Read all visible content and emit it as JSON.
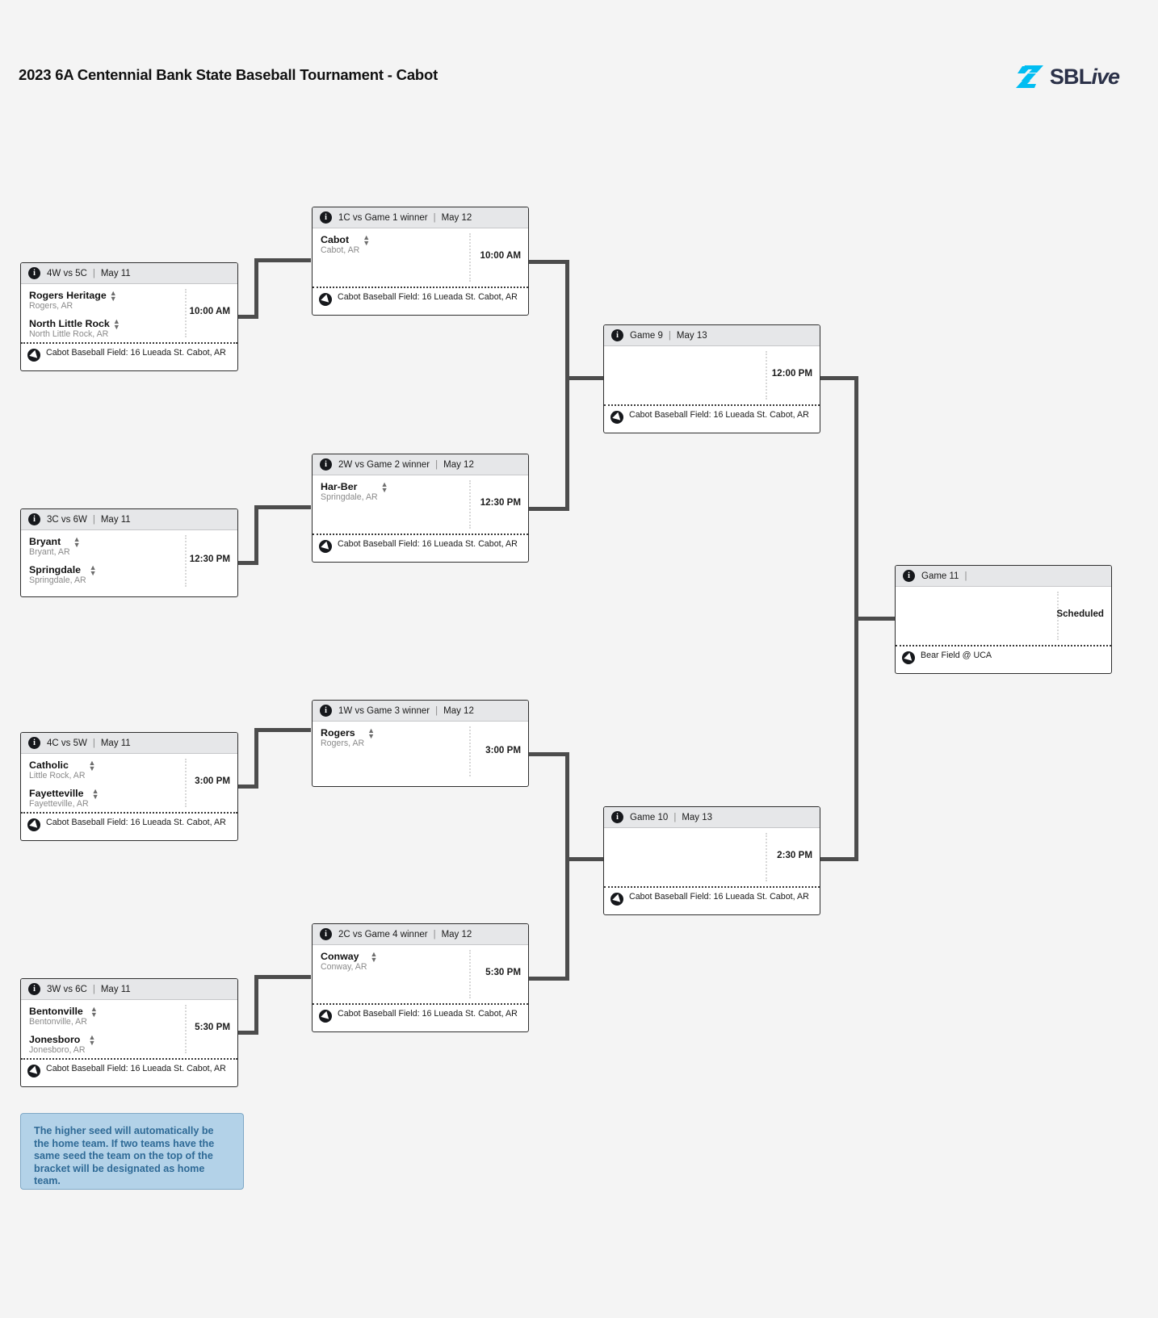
{
  "header": {
    "title": "2023 6A Centennial Bank State Baseball Tournament - Cabot",
    "logo_primary": "SBL",
    "logo_secondary": "ive",
    "logo_mark_color": "#00bdf2",
    "logo_text_color": "#2b3148"
  },
  "venues": {
    "cabot": "Cabot Baseball Field: 16 Lueada St. Cabot, AR",
    "uca": "Bear Field @ UCA"
  },
  "note": {
    "text": "The higher seed will automatically be the home team. If two teams have the same seed the team on the top of the bracket will be designated as home team.",
    "background": "#b3d2e8",
    "text_color": "#2f6a96"
  },
  "icons": {
    "info": "info-icon",
    "navigation": "navigation-icon",
    "spinner_up": "▲",
    "spinner_down": "▼",
    "separator": "|"
  },
  "games": [
    {
      "id": "game1",
      "matchup": "4W vs 5C",
      "date": "May 11",
      "time": "10:00 AM",
      "venue": "Cabot Baseball Field: 16 Lueada St. Cabot, AR",
      "teams": [
        {
          "name": "Rogers Heritage",
          "city": "Rogers, AR"
        },
        {
          "name": "North Little Rock",
          "city": "North Little Rock, AR"
        }
      ]
    },
    {
      "id": "game2",
      "matchup": "3C vs 6W",
      "date": "May 11",
      "time": "12:30 PM",
      "venue": "",
      "teams": [
        {
          "name": "Bryant",
          "city": "Bryant, AR"
        },
        {
          "name": "Springdale",
          "city": "Springdale, AR"
        }
      ]
    },
    {
      "id": "game3",
      "matchup": "4C vs 5W",
      "date": "May 11",
      "time": "3:00 PM",
      "venue": "Cabot Baseball Field: 16 Lueada St. Cabot, AR",
      "teams": [
        {
          "name": "Catholic",
          "city": "Little Rock, AR"
        },
        {
          "name": "Fayetteville",
          "city": "Fayetteville, AR"
        }
      ]
    },
    {
      "id": "game4",
      "matchup": "3W vs 6C",
      "date": "May 11",
      "time": "5:30 PM",
      "venue": "Cabot Baseball Field: 16 Lueada St. Cabot, AR",
      "teams": [
        {
          "name": "Bentonville",
          "city": "Bentonville, AR"
        },
        {
          "name": "Jonesboro",
          "city": "Jonesboro, AR"
        }
      ]
    },
    {
      "id": "game5",
      "matchup": "1C vs Game 1 winner",
      "date": "May 12",
      "time": "10:00 AM",
      "venue": "Cabot Baseball Field: 16 Lueada St. Cabot, AR",
      "teams": [
        {
          "name": "Cabot",
          "city": "Cabot, AR"
        },
        {
          "name": "",
          "city": ""
        }
      ]
    },
    {
      "id": "game6",
      "matchup": "2W vs Game 2 winner",
      "date": "May 12",
      "time": "12:30 PM",
      "venue": "Cabot Baseball Field: 16 Lueada St. Cabot, AR",
      "teams": [
        {
          "name": "Har-Ber",
          "city": "Springdale, AR"
        },
        {
          "name": "",
          "city": ""
        }
      ]
    },
    {
      "id": "game7",
      "matchup": "1W vs Game 3 winner",
      "date": "May 12",
      "time": "3:00 PM",
      "venue": "",
      "teams": [
        {
          "name": "Rogers",
          "city": "Rogers, AR"
        },
        {
          "name": "",
          "city": ""
        }
      ]
    },
    {
      "id": "game8",
      "matchup": "2C vs Game 4 winner",
      "date": "May 12",
      "time": "5:30 PM",
      "venue": "Cabot Baseball Field: 16 Lueada St. Cabot, AR",
      "teams": [
        {
          "name": "Conway",
          "city": "Conway, AR"
        },
        {
          "name": "",
          "city": ""
        }
      ]
    },
    {
      "id": "game9",
      "matchup": "Game 9",
      "date": "May 13",
      "time": "12:00 PM",
      "venue": "Cabot Baseball Field: 16 Lueada St. Cabot, AR",
      "teams": [
        {
          "name": "",
          "city": ""
        },
        {
          "name": "",
          "city": ""
        }
      ]
    },
    {
      "id": "game10",
      "matchup": "Game 10",
      "date": "May 13",
      "time": "2:30 PM",
      "venue": "Cabot Baseball Field: 16 Lueada St. Cabot, AR",
      "teams": [
        {
          "name": "",
          "city": ""
        },
        {
          "name": "",
          "city": ""
        }
      ]
    },
    {
      "id": "game11",
      "matchup": "Game 11",
      "date": "",
      "time": "Scheduled",
      "venue": "Bear Field @ UCA",
      "teams": [
        {
          "name": "",
          "city": ""
        },
        {
          "name": "",
          "city": ""
        }
      ]
    }
  ]
}
